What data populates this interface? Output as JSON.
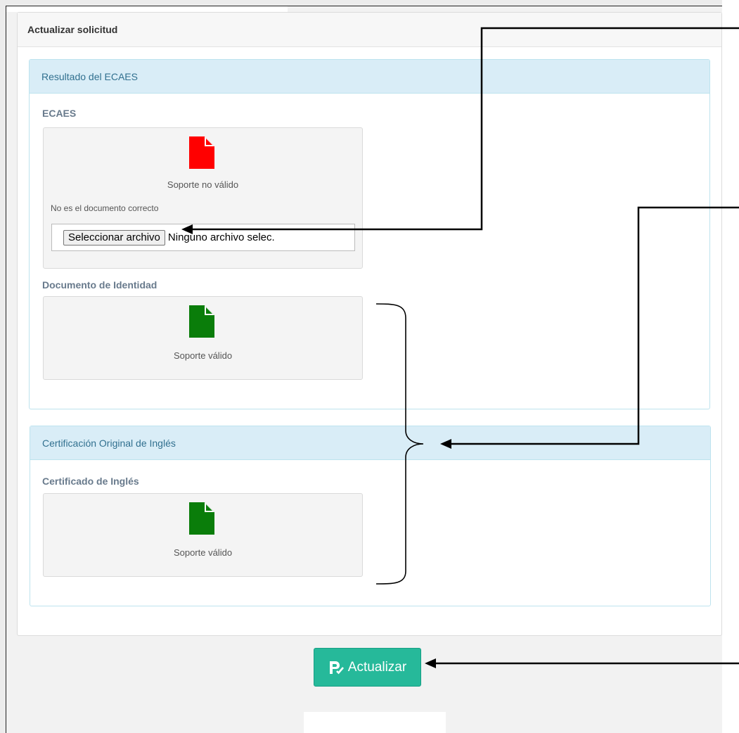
{
  "panel": {
    "title": "Actualizar solicitud"
  },
  "sections": [
    {
      "title": "Resultado del ECAES",
      "documents": [
        {
          "label": "ECAES",
          "status": "Soporte no válido",
          "note": "No es el documento correcto",
          "file_button": "Seleccionar archivo",
          "file_text": "Ninguno archivo selec.",
          "icon": "file-icon",
          "icon_color": "#ff0000"
        },
        {
          "label": "Documento de Identidad",
          "status": "Soporte válido",
          "icon": "file-icon",
          "icon_color": "#0a7d0a"
        }
      ]
    },
    {
      "title": "Certificación Original de Inglés",
      "documents": [
        {
          "label": "Certificado de Inglés",
          "status": "Soporte válido",
          "icon": "file-icon",
          "icon_color": "#0a7d0a"
        }
      ]
    }
  ],
  "submit": {
    "label": "Actualizar",
    "icon": "file-signature-icon",
    "color": "#26b99a"
  }
}
